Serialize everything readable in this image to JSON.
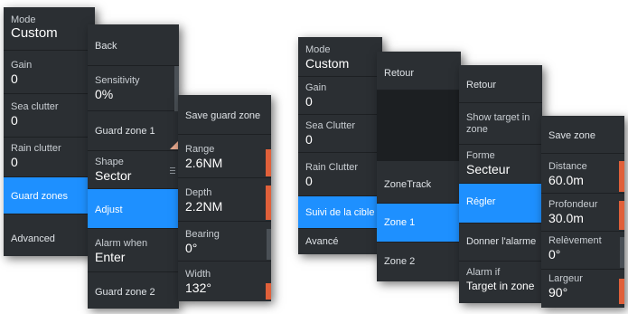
{
  "left": {
    "p1": {
      "mode_label": "Mode",
      "mode_value": "Custom",
      "gain_label": "Gain",
      "gain_value": "0",
      "sea_label": "Sea clutter",
      "sea_value": "0",
      "rain_label": "Rain clutter",
      "rain_value": "0",
      "guard_zones": "Guard zones",
      "advanced": "Advanced"
    },
    "p2": {
      "back": "Back",
      "sens_label": "Sensitivity",
      "sens_value": "0%",
      "gz1": "Guard zone 1",
      "shape_label": "Shape",
      "shape_value": "Sector",
      "adjust": "Adjust",
      "alarm_label": "Alarm when",
      "alarm_value": "Enter",
      "gz2": "Guard zone 2"
    },
    "p3": {
      "save": "Save guard zone",
      "range_label": "Range",
      "range_value": "2.6NM",
      "depth_label": "Depth",
      "depth_value": "2.2NM",
      "bearing_label": "Bearing",
      "bearing_value": "0°",
      "width_label": "Width",
      "width_value": "132°"
    }
  },
  "right": {
    "p1": {
      "mode_label": "Mode",
      "mode_value": "Custom",
      "gain_label": "Gain",
      "gain_value": "0",
      "sea_label": "Sea Clutter",
      "sea_value": "0",
      "rain_label": "Rain Clutter",
      "rain_value": "0",
      "suivi": "Suivi de la cible",
      "avance": "Avancé"
    },
    "p2": {
      "retour": "Retour",
      "zonetrack": "ZoneTrack",
      "zone1": "Zone 1",
      "zone2": "Zone 2"
    },
    "p3": {
      "retour": "Retour",
      "show_target": "Show target in zone",
      "forme_label": "Forme",
      "forme_value": "Secteur",
      "regler": "Régler",
      "donner": "Donner l'alarme",
      "alarm_label": "Alarm if",
      "alarm_value": "Target in zone"
    },
    "p4": {
      "save": "Save zone",
      "distance_label": "Distance",
      "distance_value": "60.0m",
      "prof_label": "Profondeur",
      "prof_value": "30.0m",
      "relev_label": "Relèvement",
      "relev_value": "0°",
      "largeur_label": "Largeur",
      "largeur_value": "90°"
    }
  },
  "colors": {
    "panel": "#2b2f33",
    "selected": "#1e90ff",
    "accent_bar": "#e0603a"
  }
}
